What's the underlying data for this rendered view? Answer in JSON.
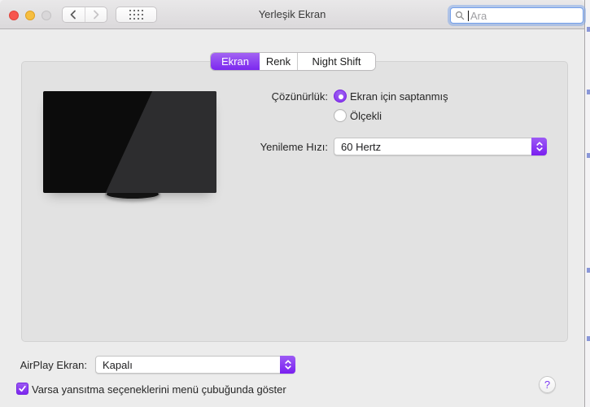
{
  "window": {
    "title": "Yerleşik Ekran",
    "help_label": "?"
  },
  "toolbar": {
    "search_placeholder": "Ara"
  },
  "tabs": [
    {
      "label": "Ekran",
      "selected": true
    },
    {
      "label": "Renk",
      "selected": false
    },
    {
      "label": "Night Shift",
      "selected": false
    }
  ],
  "main": {
    "resolution": {
      "label": "Çözünürlük:",
      "options": [
        {
          "label": "Ekran için saptanmış",
          "selected": true
        },
        {
          "label": "Ölçekli",
          "selected": false
        }
      ]
    },
    "refresh_rate": {
      "label": "Yenileme Hızı:",
      "value": "60 Hertz"
    }
  },
  "footer": {
    "airplay": {
      "label": "AirPlay Ekran:",
      "value": "Kapalı"
    },
    "mirroring": {
      "label": "Varsa yansıtma seçeneklerini menü çubuğunda göster",
      "checked": true
    }
  },
  "colors": {
    "accent_purple": "#8b3df0",
    "accent_purple_light": "#9d5bf5",
    "accent_purple_dark": "#7a1ff0",
    "search_focus_ring": "#74a0ea",
    "traffic_red": "#f7564f",
    "traffic_yellow": "#f6be40",
    "traffic_gray": "#d9d7d9",
    "window_bg": "#ececec",
    "panel_bg": "#e2e2e2"
  }
}
